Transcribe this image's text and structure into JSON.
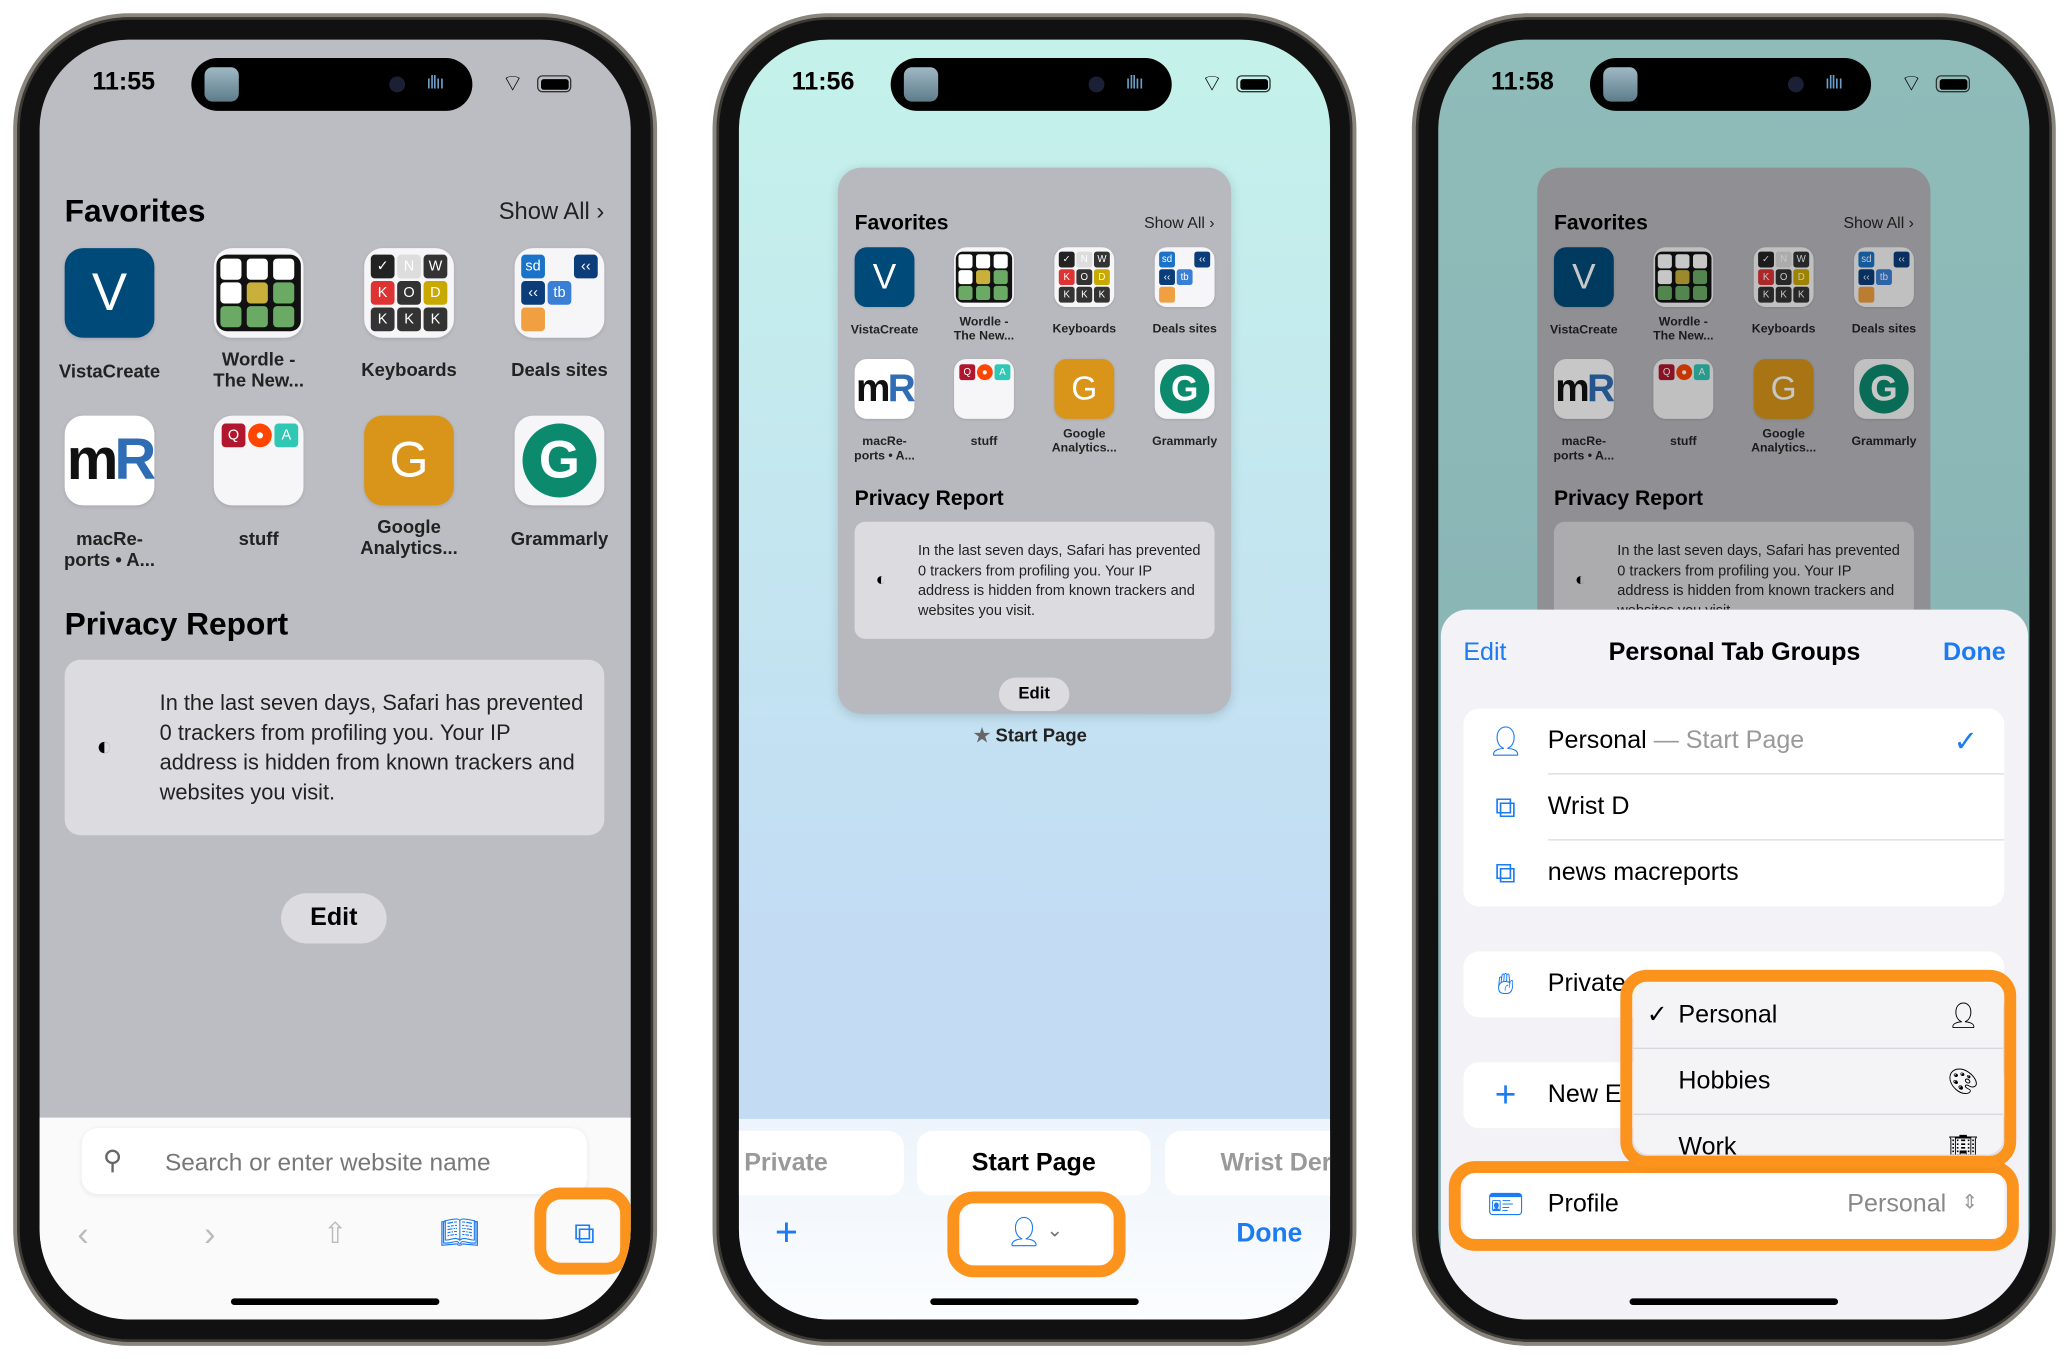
{
  "start_page": {
    "favorites_title": "Favorites",
    "show_all": "Show All",
    "favorites": [
      {
        "label": "VistaCreate",
        "icon": "vistacreate-icon",
        "glyph": "V"
      },
      {
        "label": "Wordle -\nThe New...",
        "icon": "wordle-icon"
      },
      {
        "label": "Keyboards",
        "icon": "keyboards-folder-icon",
        "glyphs": [
          "N",
          "W",
          "K",
          "O",
          "D",
          "K",
          "K",
          "K"
        ]
      },
      {
        "label": "Deals sites",
        "icon": "deals-folder-icon",
        "glyphs": [
          "sd",
          "tb"
        ]
      },
      {
        "label": "macRe-\nports • A...",
        "icon": "macreports-icon",
        "glyphs": [
          "m",
          "R"
        ]
      },
      {
        "label": "stuff",
        "icon": "stuff-folder-icon",
        "glyphs": [
          "Q",
          "A"
        ]
      },
      {
        "label": "Google\nAnalytics...",
        "icon": "google-analytics-icon",
        "glyph": "G"
      },
      {
        "label": "Grammarly",
        "icon": "grammarly-icon",
        "glyph": "G"
      }
    ],
    "privacy_title": "Privacy Report",
    "privacy_text": "In the last seven days, Safari has prevented 0 trackers from profiling you. Your IP address is hidden from known trackers and websites you visit.",
    "edit_label": "Edit"
  },
  "phone1": {
    "time": "11:55",
    "search_placeholder": "Search or enter website name",
    "toolbar": [
      "back-icon",
      "forward-icon",
      "share-icon",
      "bookmarks-icon",
      "tabs-icon"
    ]
  },
  "phone2": {
    "time": "11:56",
    "preview_label": "Start Page",
    "tabs": [
      "Private",
      "Start Page",
      "Wrist Der"
    ],
    "done": "Done"
  },
  "phone3": {
    "time": "11:58",
    "sheet": {
      "edit": "Edit",
      "title": "Personal Tab Groups",
      "done": "Done",
      "groups": [
        {
          "label": "Personal",
          "suffix": "— Start Page",
          "icon": "person-icon",
          "selected": true
        },
        {
          "label": "Wrist D",
          "icon": "tab-group-icon"
        },
        {
          "label": "news macreports",
          "icon": "tab-group-icon"
        }
      ],
      "private_label": "Private",
      "new_label": "New E",
      "profile_label": "Profile",
      "profile_value": "Personal",
      "profile_menu": [
        {
          "label": "Personal",
          "icon": "person-icon",
          "checked": true
        },
        {
          "label": "Hobbies",
          "icon": "palette-icon"
        },
        {
          "label": "Work",
          "icon": "building-icon"
        }
      ]
    }
  },
  "colors": {
    "accent": "#1a7bf2",
    "highlight": "#fb931d"
  }
}
